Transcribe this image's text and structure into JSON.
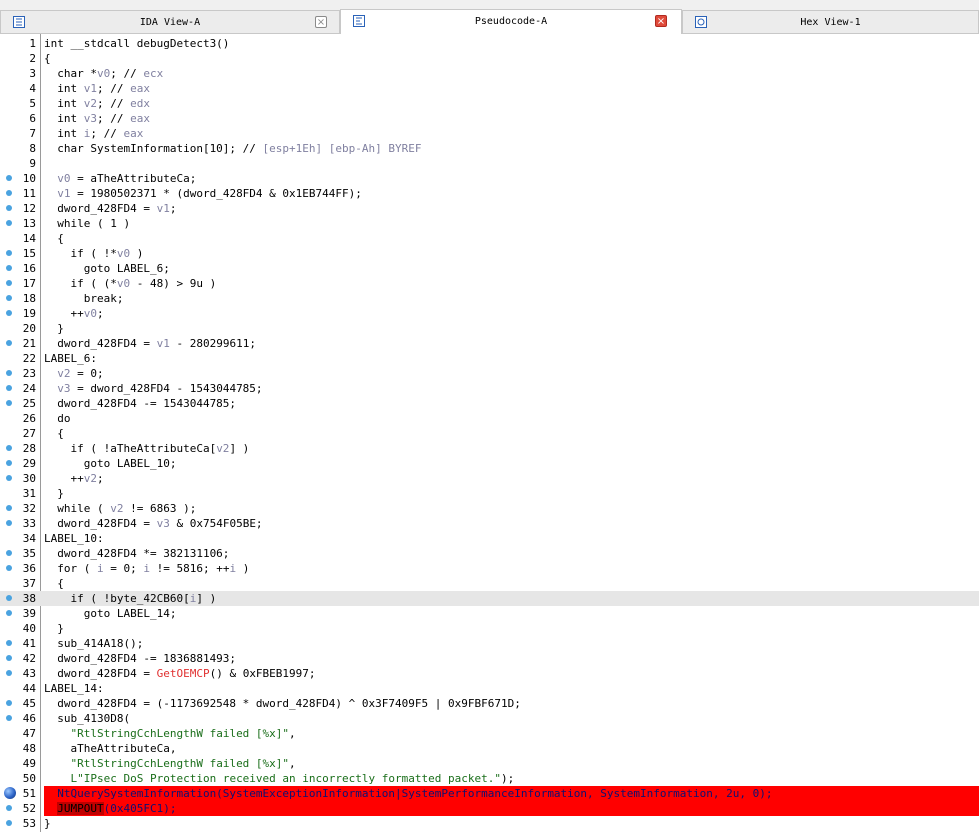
{
  "tabs": [
    {
      "label": "IDA View-A",
      "active": false,
      "closable": true
    },
    {
      "label": "Pseudocode-A",
      "active": true,
      "closable": true
    },
    {
      "label": "Hex View-1",
      "active": false,
      "closable": false
    }
  ],
  "code_lines": [
    {
      "n": "1",
      "t": "int __stdcall debugDetect3()"
    },
    {
      "n": "2",
      "t": "{"
    },
    {
      "n": "3",
      "t": "  char *v0; // ecx"
    },
    {
      "n": "4",
      "t": "  int v1; // eax"
    },
    {
      "n": "5",
      "t": "  int v2; // edx"
    },
    {
      "n": "6",
      "t": "  int v3; // eax"
    },
    {
      "n": "7",
      "t": "  int i; // eax"
    },
    {
      "n": "8",
      "t": "  char SystemInformation[10]; // [esp+1Eh] [ebp-Ah] BYREF"
    },
    {
      "n": "9",
      "t": ""
    },
    {
      "n": "10",
      "t": "  v0 = aTheAttributeCa;"
    },
    {
      "n": "11",
      "t": "  v1 = 1980502371 * (dword_428FD4 & 0x1EB744FF);"
    },
    {
      "n": "12",
      "t": "  dword_428FD4 = v1;"
    },
    {
      "n": "13",
      "t": "  while ( 1 )"
    },
    {
      "n": "14",
      "t": "  {"
    },
    {
      "n": "15",
      "t": "    if ( !*v0 )"
    },
    {
      "n": "16",
      "t": "      goto LABEL_6;"
    },
    {
      "n": "17",
      "t": "    if ( (*v0 - 48) > 9u )"
    },
    {
      "n": "18",
      "t": "      break;"
    },
    {
      "n": "19",
      "t": "    ++v0;"
    },
    {
      "n": "20",
      "t": "  }"
    },
    {
      "n": "21",
      "t": "  dword_428FD4 = v1 - 280299611;"
    },
    {
      "n": "22",
      "t": "LABEL_6:"
    },
    {
      "n": "23",
      "t": "  v2 = 0;"
    },
    {
      "n": "24",
      "t": "  v3 = dword_428FD4 - 1543044785;"
    },
    {
      "n": "25",
      "t": "  dword_428FD4 -= 1543044785;"
    },
    {
      "n": "26",
      "t": "  do"
    },
    {
      "n": "27",
      "t": "  {"
    },
    {
      "n": "28",
      "t": "    if ( !aTheAttributeCa[v2] )"
    },
    {
      "n": "29",
      "t": "      goto LABEL_10;"
    },
    {
      "n": "30",
      "t": "    ++v2;"
    },
    {
      "n": "31",
      "t": "  }"
    },
    {
      "n": "32",
      "t": "  while ( v2 != 6863 );"
    },
    {
      "n": "33",
      "t": "  dword_428FD4 = v3 & 0x754F05BE;"
    },
    {
      "n": "34",
      "t": "LABEL_10:"
    },
    {
      "n": "35",
      "t": "  dword_428FD4 *= 382131106;"
    },
    {
      "n": "36",
      "t": "  for ( i = 0; i != 5816; ++i )"
    },
    {
      "n": "37",
      "t": "  {"
    },
    {
      "n": "38",
      "t": "    if ( !byte_42CB60[i] )"
    },
    {
      "n": "39",
      "t": "      goto LABEL_14;"
    },
    {
      "n": "40",
      "t": "  }"
    },
    {
      "n": "41",
      "t": "  sub_414A18();"
    },
    {
      "n": "42",
      "t": "  dword_428FD4 -= 1836881493;"
    },
    {
      "n": "43",
      "t": "  dword_428FD4 = GetOEMCP() & 0xFBEB1997;"
    },
    {
      "n": "44",
      "t": "LABEL_14:"
    },
    {
      "n": "45",
      "t": "  dword_428FD4 = (-1173692548 * dword_428FD4) ^ 0x3F7409F5 | 0x9FBF671D;"
    },
    {
      "n": "46",
      "t": "  sub_4130D8("
    },
    {
      "n": "47",
      "t": "    \"RtlStringCchLengthW failed [%x]\","
    },
    {
      "n": "48",
      "t": "    aTheAttributeCa,"
    },
    {
      "n": "49",
      "t": "    \"RtlStringCchLengthW failed [%x]\","
    },
    {
      "n": "50",
      "t": "    L\"IPsec DoS Protection received an incorrectly formatted packet.\");"
    },
    {
      "n": "51",
      "t": "  NtQuerySystemInformation(SystemExceptionInformation|SystemPerformanceInformation, SystemInformation, 2u, 0);"
    },
    {
      "n": "52",
      "t": "  JUMPOUT(0x405FC1);"
    },
    {
      "n": "53",
      "t": "}"
    }
  ],
  "highlighted_line": "38",
  "breakpoint_line": "51",
  "error_lines": [
    "51",
    "52"
  ],
  "dotted_lines": [
    "10",
    "11",
    "12",
    "13",
    "15",
    "16",
    "17",
    "18",
    "19",
    "21",
    "23",
    "24",
    "25",
    "28",
    "29",
    "30",
    "32",
    "33",
    "35",
    "36",
    "38",
    "39",
    "41",
    "42",
    "43",
    "45",
    "46",
    "52",
    "53"
  ],
  "colors": {
    "comment": "#8080a0",
    "variable": "#8080a0",
    "string": "#1a6e1a",
    "import_function": "#e03030",
    "error_background": "#ff0000",
    "current_line": "#e6e6e6",
    "breakpoint": "#2c64c8",
    "gutter_dot": "#4aa3e0",
    "tab_close": "#e04a3a"
  }
}
